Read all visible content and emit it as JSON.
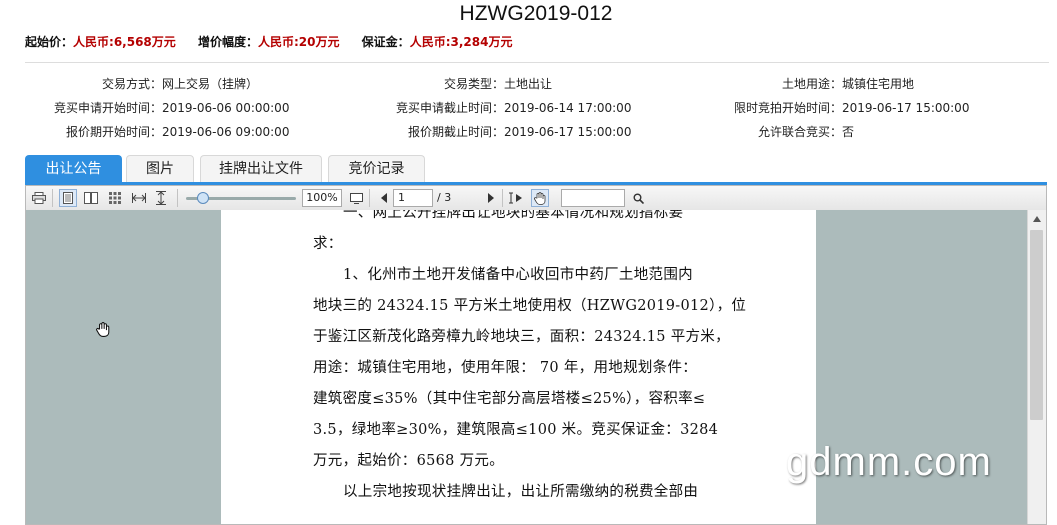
{
  "header": {
    "title": "HZWG2019-012",
    "start_price_label": "起始价：",
    "start_price_value": "人民币:6,568万元",
    "increment_label": "增价幅度：",
    "increment_value": "人民币:20万元",
    "deposit_label": "保证金：",
    "deposit_value": "人民币:3,284万元"
  },
  "info": {
    "trade_method_label": "交易方式：",
    "trade_method": "网上交易（挂牌）",
    "trade_type_label": "交易类型：",
    "trade_type": "土地出让",
    "land_use_label": "土地用途：",
    "land_use": "城镇住宅用地",
    "apply_start_label": "竞买申请开始时间：",
    "apply_start": "2019-06-06 00:00:00",
    "apply_end_label": "竞买申请截止时间：",
    "apply_end": "2019-06-14 17:00:00",
    "timed_bid_label": "限时竞拍开始时间：",
    "timed_bid": "2019-06-17 15:00:00",
    "quote_start_label": "报价期开始时间：",
    "quote_start": "2019-06-06 09:00:00",
    "quote_end_label": "报价期截止时间：",
    "quote_end": "2019-06-17 15:00:00",
    "joint_bid_label": "允许联合竞买：",
    "joint_bid": "否"
  },
  "tabs": [
    {
      "label": "出让公告",
      "active": true
    },
    {
      "label": "图片",
      "active": false
    },
    {
      "label": "挂牌出让文件",
      "active": false
    },
    {
      "label": "竞价记录",
      "active": false
    }
  ],
  "viewer": {
    "zoom": "100%",
    "page_current": "1",
    "page_total": "/ 3"
  },
  "document": {
    "lines": [
      "一、网上公开挂牌出让地块的基本情况和规划指标要",
      "求：",
      "1、化州市土地开发储备中心收回市中药厂土地范围内",
      "地块三的 24324.15 平方米土地使用权（HZWG2019-012），位",
      "于鉴江区新茂化路旁樟九岭地块三，面积：24324.15 平方米，",
      "用途：城镇住宅用地，使用年限：  70 年，用地规划条件：",
      "建筑密度≤35%（其中住宅部分高层塔楼≤25%），容积率≤",
      "3.5，绿地率≥30%，建筑限高≤100 米。竞买保证金：3284",
      "万元，起始价：6568 万元。",
      "以上宗地按现状挂牌出让，出让所需缴纳的税费全部由"
    ]
  },
  "watermark": "gdmm.com",
  "colors": {
    "accent": "#2f8fe0",
    "price_red": "#b40000",
    "canvas_bg": "#acbbbb"
  }
}
